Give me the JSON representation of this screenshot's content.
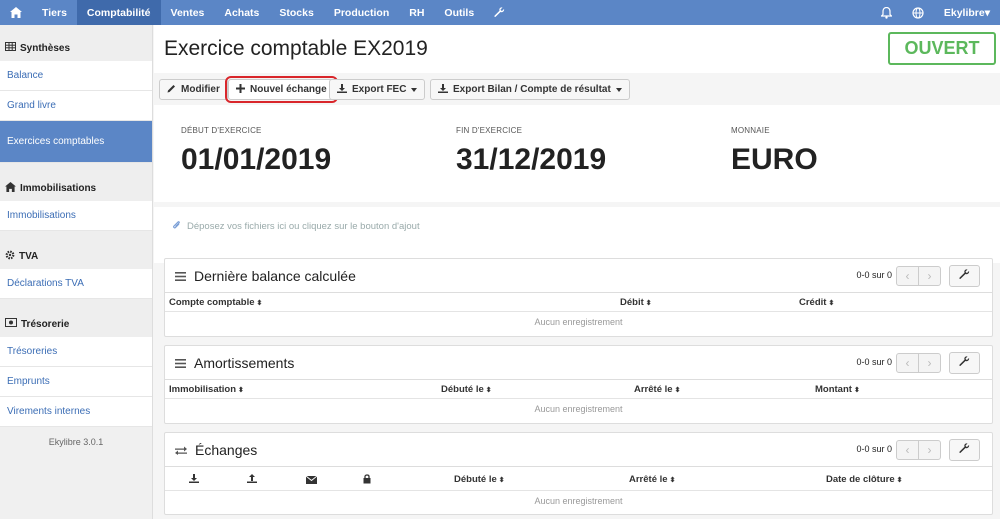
{
  "topnav": {
    "items": [
      "Tiers",
      "Comptabilité",
      "Ventes",
      "Achats",
      "Stocks",
      "Production",
      "RH",
      "Outils"
    ],
    "active_index": 1,
    "user": "Ekylibre▾"
  },
  "sidebar": {
    "sections": [
      {
        "title": "Synthèses",
        "items": [
          "Balance",
          "Grand livre",
          "Exercices comptables"
        ]
      },
      {
        "title": "Immobilisations",
        "items": [
          "Immobilisations"
        ]
      },
      {
        "title": "TVA",
        "items": [
          "Déclarations TVA"
        ]
      },
      {
        "title": "Trésorerie",
        "items": [
          "Trésoreries",
          "Emprunts",
          "Virements internes"
        ]
      }
    ],
    "active_item": "Exercices comptables",
    "version": "Ekylibre 3.0.1"
  },
  "page": {
    "title": "Exercice comptable EX2019",
    "status": "OUVERT",
    "status_color": "#5cb85c"
  },
  "toolbar": {
    "modify_label": "Modifier",
    "new_exchange_label": "Nouvel échange",
    "export_fec_label": "Export FEC",
    "export_bilan_label": "Export Bilan / Compte de résultat"
  },
  "info": {
    "start_label": "DÉBUT D'EXERCICE",
    "start_value": "01/01/2019",
    "end_label": "FIN D'EXERCICE",
    "end_value": "31/12/2019",
    "currency_label": "MONNAIE",
    "currency_value": "EURO"
  },
  "dropzone": {
    "text": "Déposez vos fichiers ici ou cliquez sur le bouton d'ajout"
  },
  "panels": {
    "balance": {
      "title": "Dernière balance calculée",
      "pager": "0-0 sur 0",
      "columns": [
        "Compte comptable",
        "Débit",
        "Crédit"
      ],
      "empty": "Aucun enregistrement"
    },
    "amortissements": {
      "title": "Amortissements",
      "pager": "0-0 sur 0",
      "columns": [
        "Immobilisation",
        "Débuté le",
        "Arrêté le",
        "Montant"
      ],
      "empty": "Aucun enregistrement"
    },
    "echanges": {
      "title": "Échanges",
      "pager": "0-0 sur 0",
      "columns": [
        "Débuté le",
        "Arrêté le",
        "Date de clôture"
      ],
      "empty": "Aucun enregistrement"
    }
  },
  "colors": {
    "brand": "#5b86c6",
    "brand_dark": "#3f6aab",
    "link": "#3b6db5",
    "highlight": "#d9262b"
  }
}
